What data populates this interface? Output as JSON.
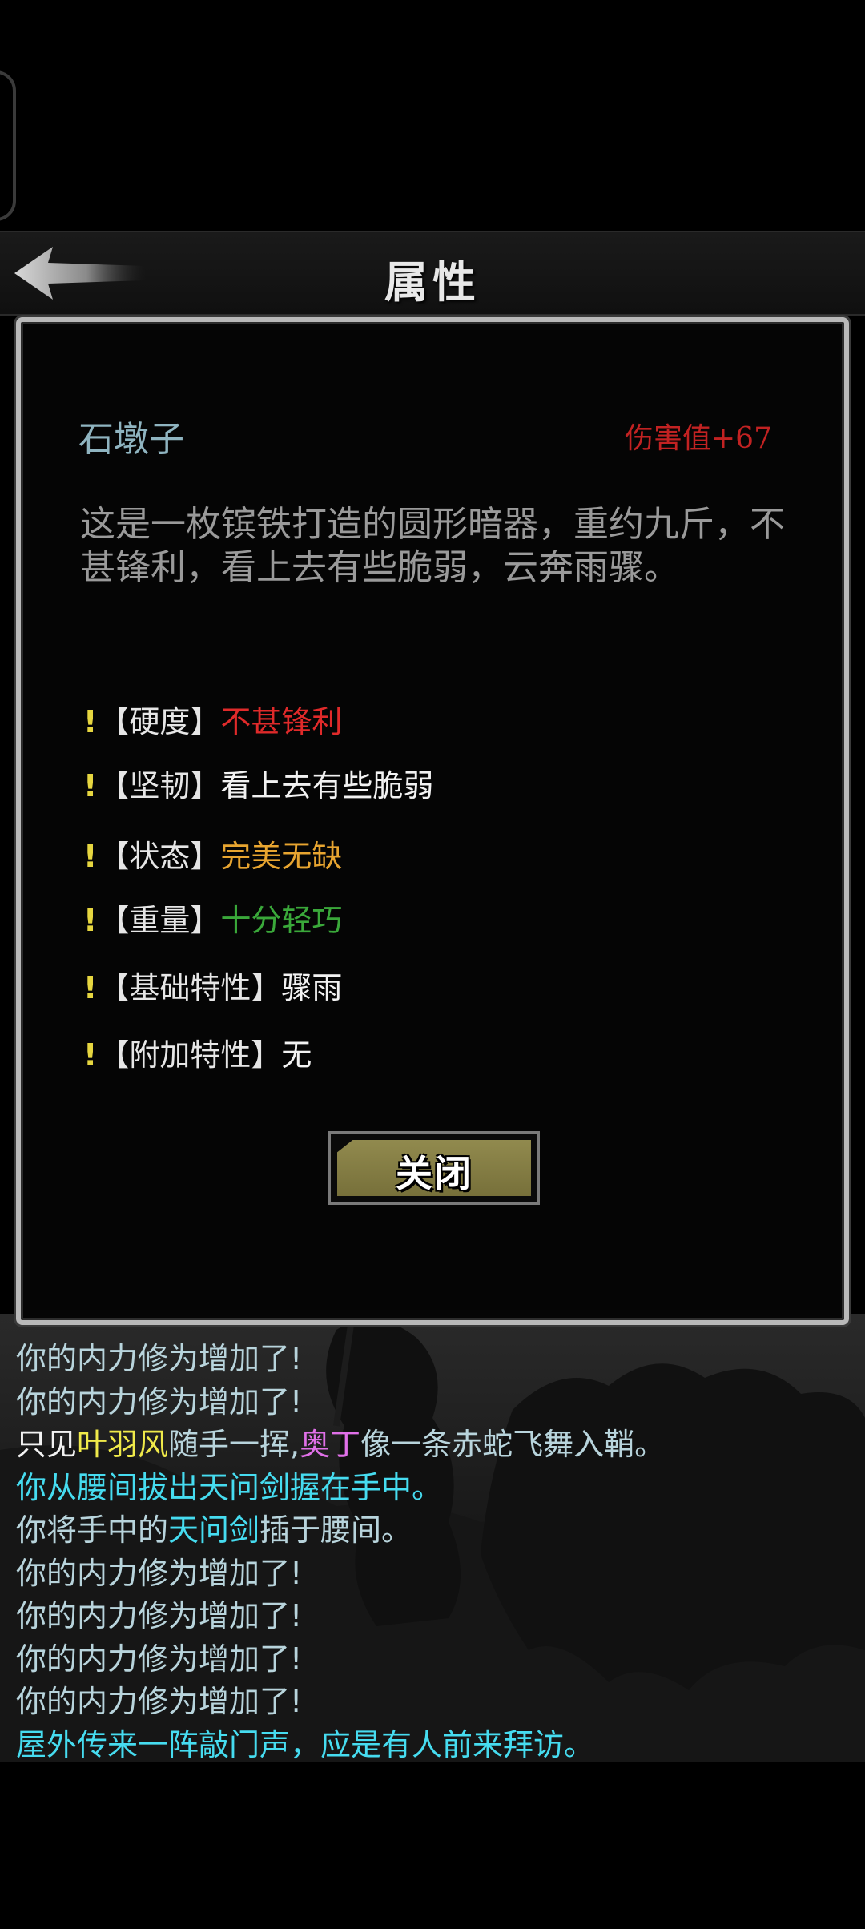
{
  "header": {
    "title": "属性"
  },
  "item": {
    "name": "石墩子",
    "damage": "伤害值+67",
    "description": "这是一枚镔铁打造的圆形暗器，重约九斤，不甚锋利，看上去有些脆弱，云奔雨骤。"
  },
  "attributes": [
    {
      "label": "【硬度】",
      "value": "不甚锋利",
      "color": "#e02a2a"
    },
    {
      "label": "【坚韧】",
      "value": "看上去有些脆弱",
      "color": "#f2f2f2"
    },
    {
      "label": "【状态】",
      "value": "完美无缺",
      "color": "#e8a530"
    },
    {
      "label": "【重量】",
      "value": "十分轻巧",
      "color": "#3aa83a"
    },
    {
      "label": "【基础特性】",
      "value": "骤雨",
      "color": "#f2f2f2"
    },
    {
      "label": "【附加特性】",
      "value": "无",
      "color": "#f2f2f2"
    }
  ],
  "bang": "!",
  "close_button": {
    "label": "关闭"
  },
  "log": [
    [
      {
        "text": "你的内力修为增加了!",
        "color": "#b8d4dc"
      }
    ],
    [
      {
        "text": "你的内力修为增加了!",
        "color": "#b8d4dc"
      }
    ],
    [
      {
        "text": "只见",
        "color": "#f2f2f2"
      },
      {
        "text": "叶羽风",
        "color": "#f0ea4a"
      },
      {
        "text": "随手一挥,",
        "color": "#b8d4dc"
      },
      {
        "text": "奥丁",
        "color": "#e070e8"
      },
      {
        "text": "像一条赤蛇飞舞入鞘。",
        "color": "#b8d4dc"
      }
    ],
    [
      {
        "text": "你从腰间拔出天问剑握在手中。",
        "color": "#46dcf0"
      }
    ],
    [
      {
        "text": "你将手中的",
        "color": "#b8d4dc"
      },
      {
        "text": "天问剑",
        "color": "#46dcf0"
      },
      {
        "text": "插于腰间。",
        "color": "#b8d4dc"
      }
    ],
    [
      {
        "text": "你的内力修为增加了!",
        "color": "#b8d4dc"
      }
    ],
    [
      {
        "text": "你的内力修为增加了!",
        "color": "#b8d4dc"
      }
    ],
    [
      {
        "text": "你的内力修为增加了!",
        "color": "#b8d4dc"
      }
    ],
    [
      {
        "text": "你的内力修为增加了!",
        "color": "#b8d4dc"
      }
    ],
    [
      {
        "text": "屋外传来一阵敲门声，应是有人前来拜访。",
        "color": "#46dcf0"
      }
    ]
  ]
}
